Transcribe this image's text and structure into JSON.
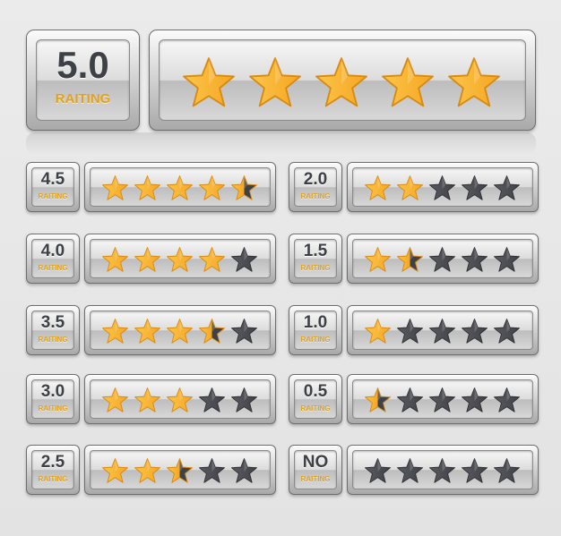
{
  "label": "RAITING",
  "colors": {
    "filled": "#f6a623",
    "filled_light": "#fbc54a",
    "filled_dark": "#d88a10",
    "empty": "#3f4146",
    "empty_light": "#5a5c61",
    "outline": "#2f3034"
  },
  "max_stars": 5,
  "featured": {
    "score": "5.0",
    "value": 5
  },
  "ratings": [
    {
      "score": "4.5",
      "value": 4.5
    },
    {
      "score": "2.0",
      "value": 2
    },
    {
      "score": "4.0",
      "value": 4
    },
    {
      "score": "1.5",
      "value": 1.5
    },
    {
      "score": "3.5",
      "value": 3.5
    },
    {
      "score": "1.0",
      "value": 1
    },
    {
      "score": "3.0",
      "value": 3
    },
    {
      "score": "0.5",
      "value": 0.5
    },
    {
      "score": "2.5",
      "value": 2.5
    },
    {
      "score": "NO",
      "value": 0
    }
  ]
}
